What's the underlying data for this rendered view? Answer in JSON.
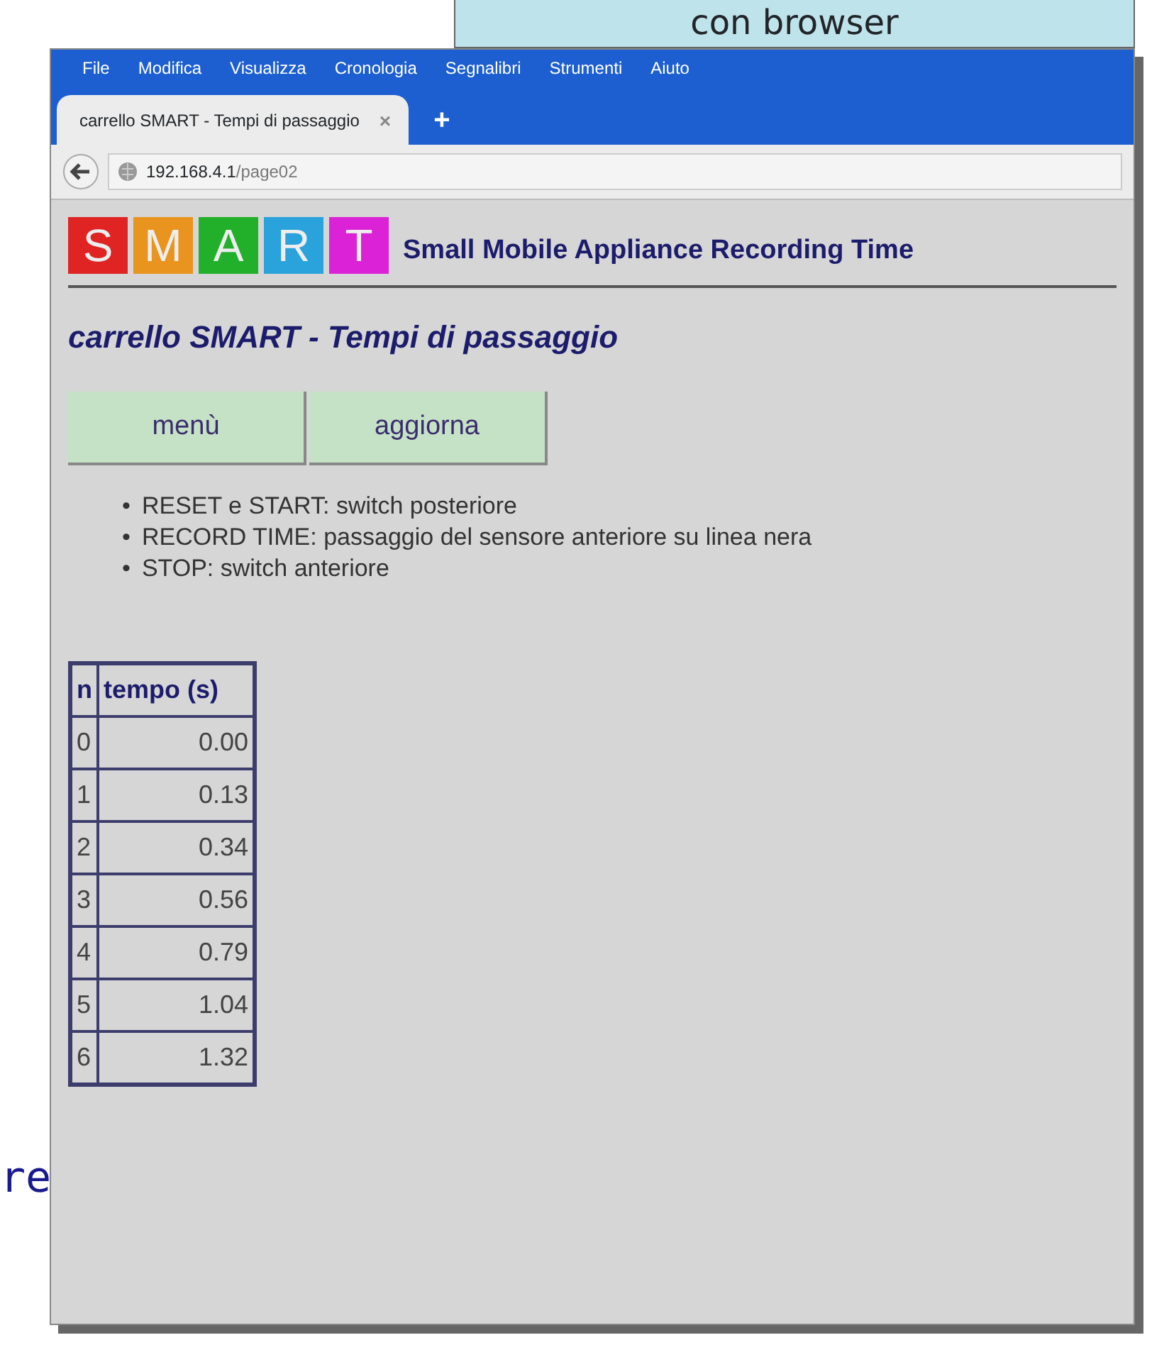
{
  "slide": {
    "callout": "con browser",
    "fragment": "re"
  },
  "browser": {
    "menu": [
      "File",
      "Modifica",
      "Visualizza",
      "Cronologia",
      "Segnalibri",
      "Strumenti",
      "Aiuto"
    ],
    "tab": {
      "title": "carrello SMART - Tempi di passaggio",
      "close": "×",
      "new": "+",
      "selected": true
    },
    "address": {
      "host": "192.168.4.1",
      "path": "/page02"
    }
  },
  "page": {
    "logo": [
      {
        "letter": "S",
        "color": "#e02424"
      },
      {
        "letter": "M",
        "color": "#e8941e"
      },
      {
        "letter": "A",
        "color": "#22b02a"
      },
      {
        "letter": "R",
        "color": "#2aa2dc"
      },
      {
        "letter": "T",
        "color": "#dc22d6"
      }
    ],
    "tagline": "Small Mobile Appliance Recording Time",
    "heading": "carrello SMART - Tempi di passaggio",
    "buttons": [
      "menù",
      "aggiorna"
    ],
    "notes": [
      {
        "bullet": "•",
        "text": "RESET e START: switch posteriore"
      },
      {
        "bullet": "•",
        "text": "RECORD TIME: passaggio del sensore anteriore su linea nera"
      },
      {
        "bullet": "•",
        "text": "STOP: switch anteriore"
      }
    ],
    "table": {
      "columns": [
        "n",
        "tempo (s)"
      ],
      "rows": [
        [
          "0",
          "0.00"
        ],
        [
          "1",
          "0.13"
        ],
        [
          "2",
          "0.34"
        ],
        [
          "3",
          "0.56"
        ],
        [
          "4",
          "0.79"
        ],
        [
          "5",
          "1.04"
        ],
        [
          "6",
          "1.32"
        ]
      ]
    }
  }
}
